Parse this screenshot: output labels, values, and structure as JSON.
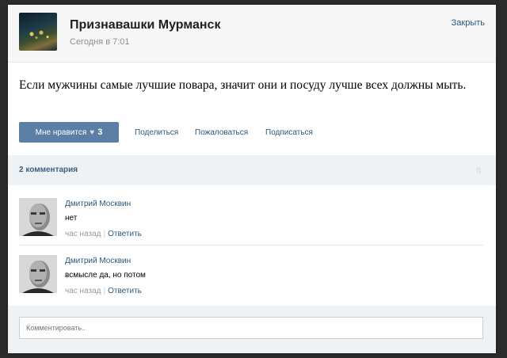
{
  "post": {
    "group_name": "Признавашки Мурманск",
    "time": "Сегодня в 7:01",
    "close_label": "Закрыть",
    "text": "Если мужчины самые лучшие повара, значит они и посуду лучше всех должны мыть.",
    "like_label": "Мне нравится",
    "like_count": "3",
    "actions": [
      "Поделиться",
      "Пожаловаться",
      "Подписаться"
    ]
  },
  "comments_header": {
    "count_label": "2 комментария",
    "sort_icon": "sort-arrows-icon"
  },
  "comments": [
    {
      "author": "Дмитрий Москвин",
      "text": "нет",
      "time": "час назад",
      "reply": "Ответить"
    },
    {
      "author": "Дмитрий Москвин",
      "text": "всмысле да, но потом",
      "time": "час назад",
      "reply": "Ответить"
    }
  ],
  "comment_input": {
    "placeholder": "Комментировать.."
  },
  "colors": {
    "link": "#2b587a",
    "like_button": "#5b7ea5",
    "bar": "#eff2f5"
  }
}
